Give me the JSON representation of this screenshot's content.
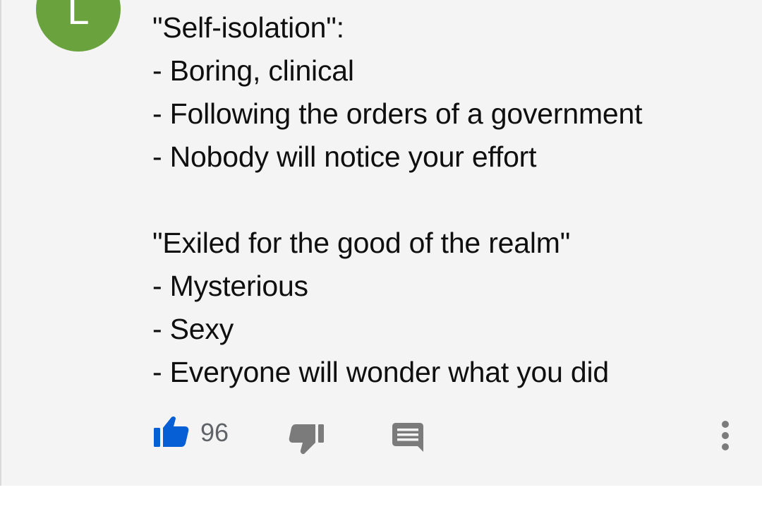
{
  "comment": {
    "avatar_letter": "L",
    "lines": [
      "\"Self-isolation\":",
      "- Boring, clinical",
      "- Following the orders of a government",
      "- Nobody will notice your effort",
      "",
      "\"Exiled for the good of the realm\"",
      "- Mysterious",
      "- Sexy",
      "- Everyone will wonder what you did"
    ]
  },
  "actions": {
    "like_count": "96",
    "icons": {
      "like": "thumbs-up-icon",
      "dislike": "thumbs-down-icon",
      "reply": "comment-icon",
      "menu": "more-vertical-icon"
    }
  },
  "colors": {
    "avatar_background": "#6aa33d",
    "like_active": "#065fd4",
    "icon_gray": "#7b7b7b"
  }
}
